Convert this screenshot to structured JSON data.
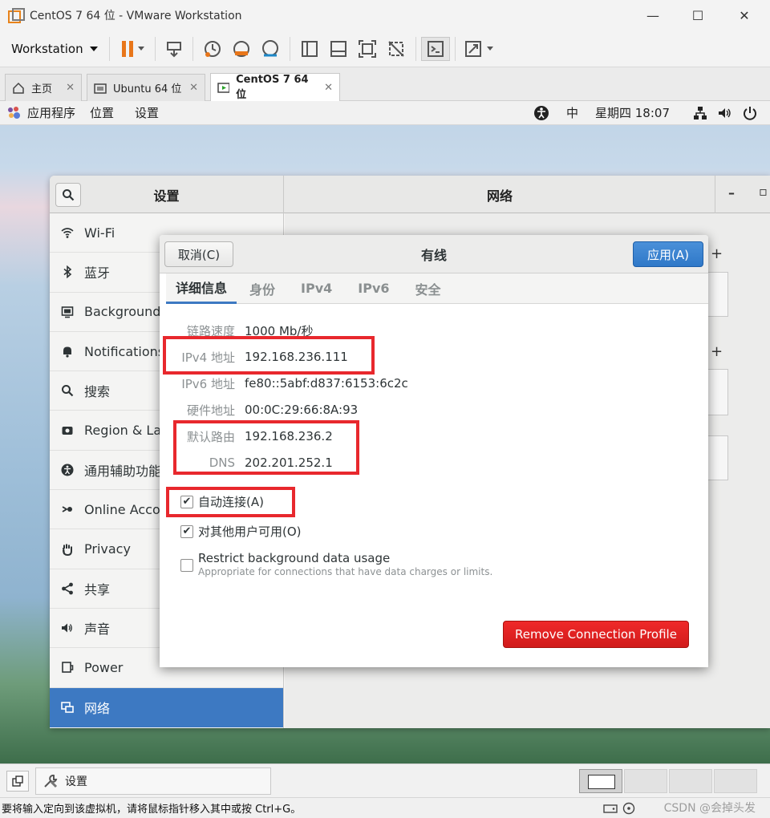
{
  "window": {
    "title": "CentOS 7 64 位 - VMware Workstation",
    "controls": {
      "minimize": "—",
      "maximize": "☐",
      "close": "✕"
    }
  },
  "toolbar": {
    "menu_label": "Workstation"
  },
  "tabs": [
    {
      "label": "主页",
      "close": "✕"
    },
    {
      "label": "Ubuntu 64 位",
      "close": "✕"
    },
    {
      "label": "CentOS 7 64 位",
      "close": "✕"
    }
  ],
  "gnome_bar": {
    "applications": "应用程序",
    "places": "位置",
    "settings": "设置",
    "input_method": "中",
    "clock": "星期四 18:07"
  },
  "settings": {
    "left_title": "设置",
    "right_title": "网络",
    "sidebar": [
      {
        "label": "Wi-Fi",
        "icon": "wifi-icon"
      },
      {
        "label": "蓝牙",
        "icon": "bluetooth-icon"
      },
      {
        "label": "Background",
        "icon": "background-icon"
      },
      {
        "label": "Notifications",
        "icon": "bell-icon"
      },
      {
        "label": "搜索",
        "icon": "search-icon"
      },
      {
        "label": "Region & Lan",
        "icon": "flag-icon"
      },
      {
        "label": "通用辅助功能",
        "icon": "accessibility-icon"
      },
      {
        "label": "Online Accou",
        "icon": "online-accounts-icon"
      },
      {
        "label": "Privacy",
        "icon": "hand-icon"
      },
      {
        "label": "共享",
        "icon": "share-icon"
      },
      {
        "label": "声音",
        "icon": "speaker-icon"
      },
      {
        "label": "Power",
        "icon": "power-icon"
      },
      {
        "label": "网络",
        "icon": "network-icon",
        "active": true
      }
    ]
  },
  "dialog": {
    "cancel_label": "取消(C)",
    "title": "有线",
    "apply_label": "应用(A)",
    "tabs": [
      "详细信息",
      "身份",
      "IPv4",
      "IPv6",
      "安全"
    ],
    "details": [
      {
        "key": "链路速度",
        "value": "1000 Mb/秒"
      },
      {
        "key": "IPv4 地址",
        "value": "192.168.236.111"
      },
      {
        "key": "IPv6 地址",
        "value": "fe80::5abf:d837:6153:6c2c"
      },
      {
        "key": "硬件地址",
        "value": "00:0C:29:66:8A:93"
      },
      {
        "key": "默认路由",
        "value": "192.168.236.2"
      },
      {
        "key": "DNS",
        "value": "202.201.252.1"
      }
    ],
    "auto_connect": {
      "label": "自动连接(A)",
      "checked": true
    },
    "all_users": {
      "label": "对其他用户可用(O)",
      "checked": true
    },
    "restrict": {
      "label": "Restrict background data usage",
      "note": "Appropriate for connections that have data charges or limits.",
      "checked": false
    },
    "remove_label": "Remove Connection Profile"
  },
  "taskbar": {
    "item_label": "设置"
  },
  "host_status": {
    "message": "要将输入定向到该虚拟机，请将鼠标指针移入其中或按 Ctrl+G。",
    "watermark": "CSDN @会掉头发"
  },
  "colors": {
    "accent": "#3d79c2",
    "highlight_box": "#e8282d",
    "danger": "#e02424"
  }
}
